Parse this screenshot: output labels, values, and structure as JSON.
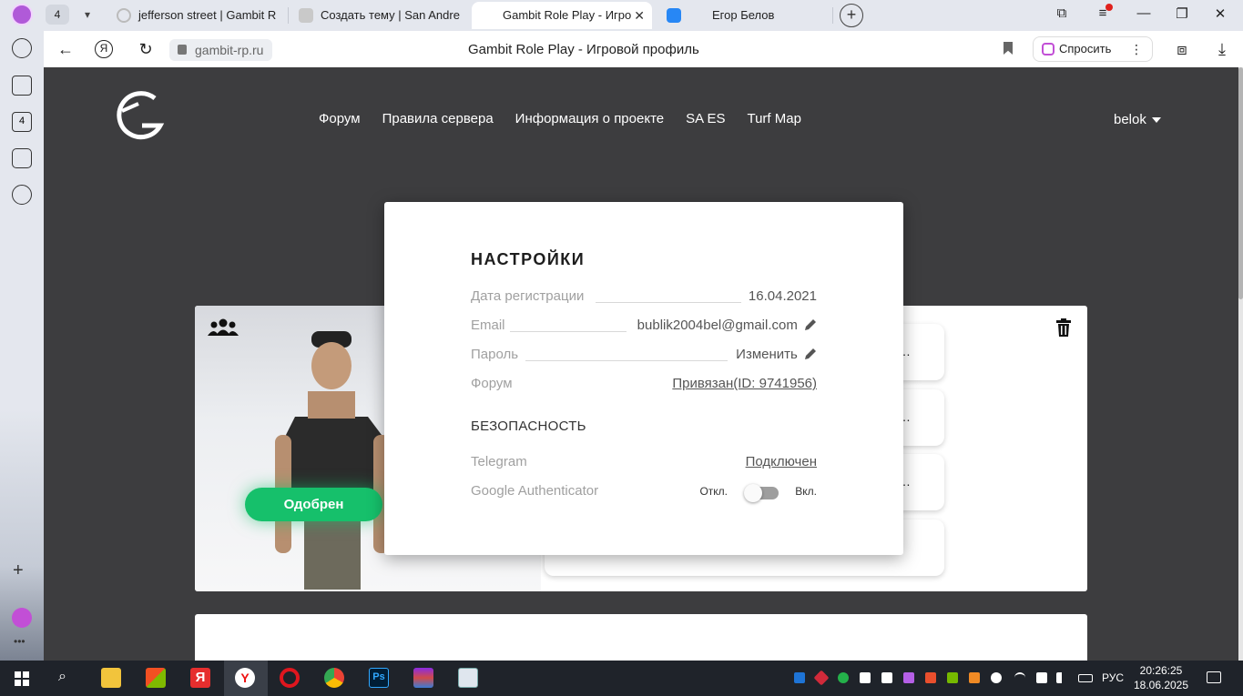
{
  "browser": {
    "tab_count": "4",
    "tabs": [
      {
        "label": "jefferson street | Gambit R",
        "active": false
      },
      {
        "label": "Создать тему | San Andre",
        "active": false
      },
      {
        "label": "Gambit Role Play - Игро",
        "active": true
      },
      {
        "label": "Егор Белов",
        "active": false
      }
    ],
    "address_host": "gambit-rp.ru",
    "page_title": "Gambit Role Play - Игровой профиль",
    "ask_label": "Спросить"
  },
  "site": {
    "nav": [
      "Форум",
      "Правила сервера",
      "Информация о проекте",
      "SA ES",
      "Turf Map"
    ],
    "username": "belok",
    "approved_label": "Одобрен"
  },
  "settings": {
    "title": "НАСТРОЙКИ",
    "registration_label": "Дата регистрации",
    "registration_value": "16.04.2021",
    "email_label": "Email",
    "email_value": "bublik2004bel@gmail.com",
    "password_label": "Пароль",
    "password_value": "Изменить",
    "forum_label": "Форум",
    "forum_value": "Привязан(ID: 9741956)",
    "security_title": "БЕЗОПАСНОСТЬ",
    "telegram_label": "Telegram",
    "telegram_value": "Подключен",
    "ga_label": "Google Authenticator",
    "ga_off": "Откл.",
    "ga_on": "Вкл.",
    "ga_enabled": false
  },
  "taskbar": {
    "lang": "РУС",
    "time": "20:26:25",
    "date": "18.06.2025"
  },
  "colors": {
    "site_bg": "#3d3d3f",
    "approved": "#16c06b",
    "browser_chrome": "#e4e7ee"
  }
}
